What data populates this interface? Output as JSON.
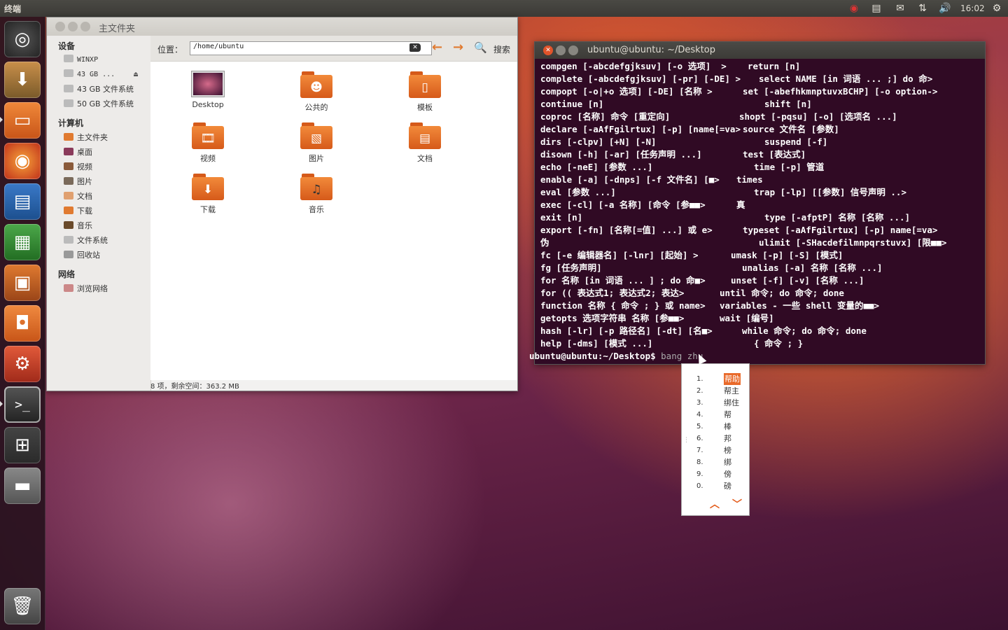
{
  "top_panel": {
    "app_title": "终端",
    "clock": "16:02"
  },
  "file_manager": {
    "title": "主文件夹",
    "sidebar": {
      "devices_header": "设备",
      "devices": [
        "WINXP",
        "43 GB ...",
        "43 GB 文件系统",
        "50 GB 文件系统"
      ],
      "computer_header": "计算机",
      "computer": [
        "主文件夹",
        "桌面",
        "视频",
        "图片",
        "文档",
        "下载",
        "音乐",
        "文件系统",
        "回收站"
      ],
      "network_header": "网络",
      "network": [
        "浏览网络"
      ]
    },
    "toolbar": {
      "location_label": "位置：",
      "location_value": "/home/ubuntu",
      "search_label": "搜索"
    },
    "items": [
      "Desktop",
      "公共的",
      "模板",
      "视频",
      "图片",
      "文档",
      "下载",
      "音乐"
    ],
    "status": "8 项，剩余空间：363.2 MB"
  },
  "terminal": {
    "title": "ubuntu@ubuntu: ~/Desktop",
    "lines": [
      {
        "left": "compgen [-abcdefgjksuv] [-o 选项]  >",
        "right": "return [n]"
      },
      {
        "left": "complete [-abcdefgjksuv] [-pr] [-DE] >",
        "right": "select NAME [in 词语 ... ;] do 命>"
      },
      {
        "left": "compopt [-o|+o 选项] [-DE] [名称 >",
        "right": "set [-abefhkmnptuvxBCHP] [-o option->"
      },
      {
        "left": "continue [n]",
        "right": "shift [n]"
      },
      {
        "left": "coproc [名称] 命令 [重定向]",
        "right": "shopt [-pqsu] [-o] [选项名 ...]"
      },
      {
        "left": "declare [-aAfFgilrtux] [-p] [name[=va>",
        "right": "source 文件名 [参数]"
      },
      {
        "left": "dirs [-clpv] [+N] [-N]",
        "right": "suspend [-f]"
      },
      {
        "left": "disown [-h] [-ar] [任务声明 ...]",
        "right": "test [表达式]"
      },
      {
        "left": "echo [-neE] [参数 ...]",
        "right": "time [-p] 管道"
      },
      {
        "left": "enable [-a] [-dnps] [-f 文件名] [■>",
        "right": "times"
      },
      {
        "left": "eval [参数 ...]",
        "right": "trap [-lp] [[参数] 信号声明 ..>"
      },
      {
        "left": "exec [-cl] [-a 名称] [命令 [参■■>",
        "right": "真"
      },
      {
        "left": "exit [n]",
        "right": "type [-afptP] 名称 [名称 ...]"
      },
      {
        "left": "export [-fn] [名称[=值] ...] 或 e>",
        "right": "typeset [-aAfFgilrtux] [-p] name[=va>"
      },
      {
        "left": "伪",
        "right": "ulimit [-SHacdefilmnpqrstuvx] [限■■>"
      },
      {
        "left": "fc [-e 编辑器名] [-lnr] [起始] >",
        "right": "umask [-p] [-S] [模式]"
      },
      {
        "left": "fg [任务声明]",
        "right": "unalias [-a] 名称 [名称 ...]"
      },
      {
        "left": "for 名称 [in 词语 ... ] ; do 命■>",
        "right": "unset [-f] [-v] [名称 ...]"
      },
      {
        "left": "for (( 表达式1; 表达式2; 表达>",
        "right": "until 命令; do 命令; done"
      },
      {
        "left": "function 名称 { 命令 ; } 或 name>",
        "right": "variables - 一些 shell 变量的■■>"
      },
      {
        "left": "getopts 选项字符串 名称 [参■■>",
        "right": "wait [编号]"
      },
      {
        "left": "hash [-lr] [-p 路径名] [-dt] [名■>",
        "right": "while 命令; do 命令; done"
      },
      {
        "left": "help [-dms] [模式 ...]",
        "right": "{ 命令 ; }"
      }
    ],
    "prompt": "ubuntu@ubuntu:~/Desktop$ ",
    "preedit": "bang zhu"
  },
  "ime": {
    "candidates": [
      {
        "num": "1.",
        "word": "帮助"
      },
      {
        "num": "2.",
        "word": "帮主"
      },
      {
        "num": "3.",
        "word": "绑住"
      },
      {
        "num": "4.",
        "word": "帮"
      },
      {
        "num": "5.",
        "word": "棒"
      },
      {
        "num": "6.",
        "word": "邦"
      },
      {
        "num": "7.",
        "word": "榜"
      },
      {
        "num": "8.",
        "word": "绑"
      },
      {
        "num": "9.",
        "word": "傍"
      },
      {
        "num": "0.",
        "word": "磅"
      }
    ],
    "selected_index": 0
  },
  "launcher": {
    "items": [
      "dash-home",
      "install-ubuntu",
      "home-folder",
      "firefox",
      "libreoffice-writer",
      "libreoffice-calc",
      "libreoffice-impress",
      "software-center",
      "system-settings",
      "terminal",
      "workspace-switcher",
      "disk-drive",
      "trash"
    ]
  },
  "colors": {
    "ubuntu_orange": "#e95420",
    "terminal_bg": "#300a24",
    "selection": "#e96a2a"
  }
}
